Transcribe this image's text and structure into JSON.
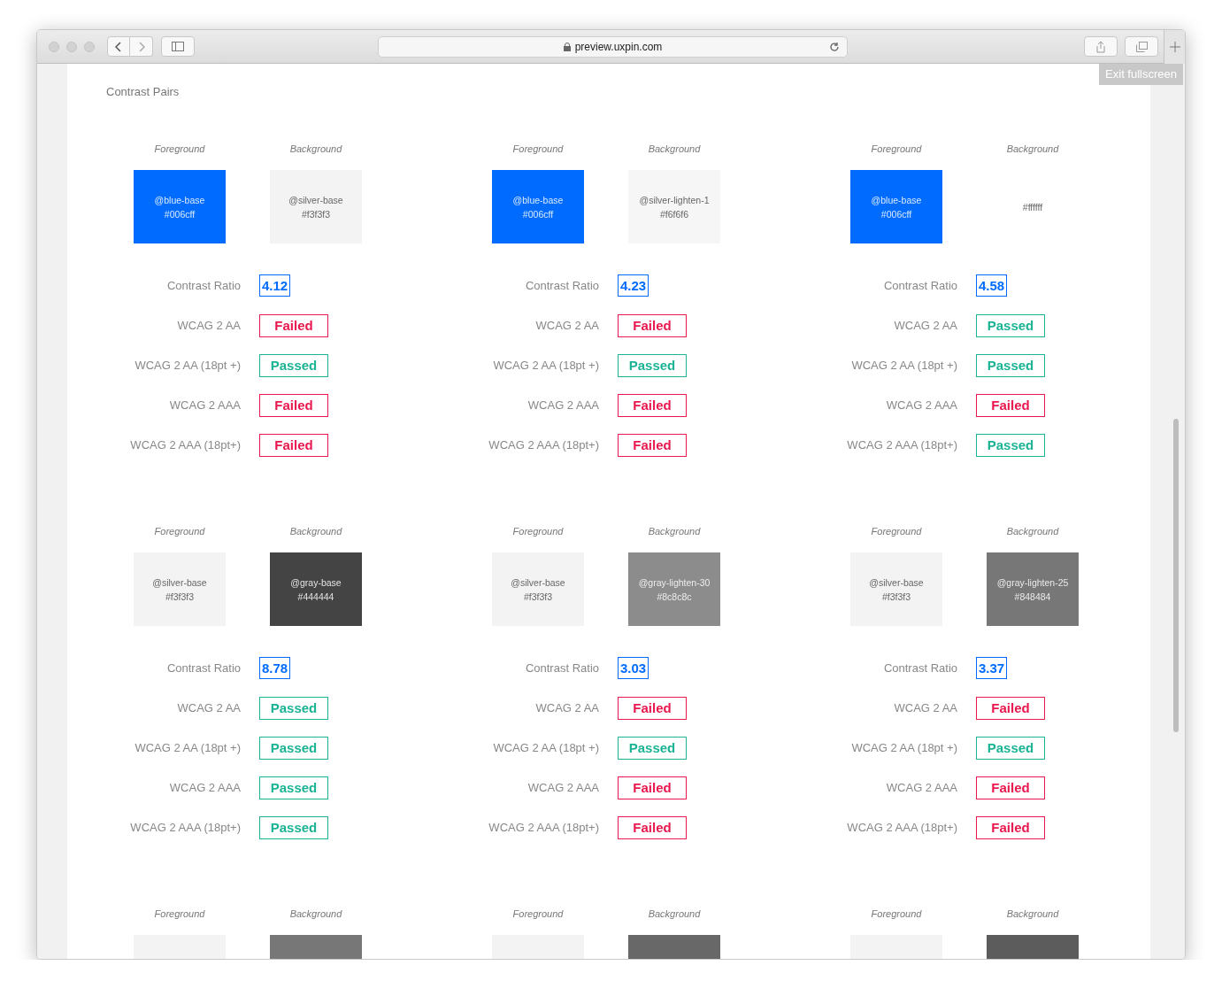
{
  "browser": {
    "address": "preview.uxpin.com",
    "overlay": "Exit fullscreen"
  },
  "page": {
    "title": "Contrast Pairs",
    "pairs": [
      {
        "foreground": {
          "label": "Foreground",
          "color": "#006cff",
          "name": "@blue-base",
          "hex": "#006cff"
        },
        "background": {
          "label": "Background",
          "color": "#f3f3f3",
          "name": "@silver-base",
          "hex": "#f3f3f3"
        },
        "ratio_label": "Contrast Ratio",
        "ratio": "4.12",
        "checks": [
          {
            "label": "WCAG 2 AA",
            "result": "Failed",
            "passed": false
          },
          {
            "label": "WCAG 2 AA (18pt +)",
            "result": "Passed",
            "passed": true
          },
          {
            "label": "WCAG 2 AAA",
            "result": "Failed",
            "passed": false
          },
          {
            "label": "WCAG 2 AAA (18pt+)",
            "result": "Failed",
            "passed": false
          }
        ]
      },
      {
        "foreground": {
          "label": "Foreground",
          "color": "#006cff",
          "name": "@blue-base",
          "hex": "#006cff"
        },
        "background": {
          "label": "Background",
          "color": "#f6f6f6",
          "name": "@silver-lighten-1",
          "hex": "#f6f6f6"
        },
        "ratio_label": "Contrast Ratio",
        "ratio": "4.23",
        "checks": [
          {
            "label": "WCAG 2 AA",
            "result": "Failed",
            "passed": false
          },
          {
            "label": "WCAG 2 AA (18pt +)",
            "result": "Passed",
            "passed": true
          },
          {
            "label": "WCAG 2 AAA",
            "result": "Failed",
            "passed": false
          },
          {
            "label": "WCAG 2 AAA (18pt+)",
            "result": "Failed",
            "passed": false
          }
        ]
      },
      {
        "foreground": {
          "label": "Foreground",
          "color": "#006cff",
          "name": "@blue-base",
          "hex": "#006cff"
        },
        "background": {
          "label": "Background",
          "color": "#ffffff",
          "hex": "#ffffff"
        },
        "ratio_label": "Contrast Ratio",
        "ratio": "4.58",
        "checks": [
          {
            "label": "WCAG 2 AA",
            "result": "Passed",
            "passed": true
          },
          {
            "label": "WCAG 2 AA (18pt +)",
            "result": "Passed",
            "passed": true
          },
          {
            "label": "WCAG 2 AAA",
            "result": "Failed",
            "passed": false
          },
          {
            "label": "WCAG 2 AAA (18pt+)",
            "result": "Passed",
            "passed": true
          }
        ]
      },
      {
        "foreground": {
          "label": "Foreground",
          "color": "#f3f3f3",
          "name": "@silver-base",
          "hex": "#f3f3f3"
        },
        "background": {
          "label": "Background",
          "color": "#444444",
          "name": "@gray-base",
          "hex": "#444444"
        },
        "ratio_label": "Contrast Ratio",
        "ratio": "8.78",
        "checks": [
          {
            "label": "WCAG 2 AA",
            "result": "Passed",
            "passed": true
          },
          {
            "label": "WCAG 2 AA (18pt +)",
            "result": "Passed",
            "passed": true
          },
          {
            "label": "WCAG 2 AAA",
            "result": "Passed",
            "passed": true
          },
          {
            "label": "WCAG 2 AAA (18pt+)",
            "result": "Passed",
            "passed": true
          }
        ]
      },
      {
        "foreground": {
          "label": "Foreground",
          "color": "#f3f3f3",
          "name": "@silver-base",
          "hex": "#f3f3f3"
        },
        "background": {
          "label": "Background",
          "color": "#8c8c8c",
          "name": "@gray-lighten-30",
          "hex": "#8c8c8c"
        },
        "ratio_label": "Contrast Ratio",
        "ratio": "3.03",
        "checks": [
          {
            "label": "WCAG 2 AA",
            "result": "Failed",
            "passed": false
          },
          {
            "label": "WCAG 2 AA (18pt +)",
            "result": "Passed",
            "passed": true
          },
          {
            "label": "WCAG 2 AAA",
            "result": "Failed",
            "passed": false
          },
          {
            "label": "WCAG 2 AAA (18pt+)",
            "result": "Failed",
            "passed": false
          }
        ]
      },
      {
        "foreground": {
          "label": "Foreground",
          "color": "#f3f3f3",
          "name": "@silver-base",
          "hex": "#f3f3f3"
        },
        "background": {
          "label": "Background",
          "color": "#777777",
          "name": "@gray-lighten-25",
          "hex": "#848484"
        },
        "ratio_label": "Contrast Ratio",
        "ratio": "3.37",
        "checks": [
          {
            "label": "WCAG 2 AA",
            "result": "Failed",
            "passed": false
          },
          {
            "label": "WCAG 2 AA (18pt +)",
            "result": "Passed",
            "passed": true
          },
          {
            "label": "WCAG 2 AAA",
            "result": "Failed",
            "passed": false
          },
          {
            "label": "WCAG 2 AAA (18pt+)",
            "result": "Failed",
            "passed": false
          }
        ]
      },
      {
        "foreground": {
          "label": "Foreground",
          "color": "#f3f3f3"
        },
        "background": {
          "label": "Background",
          "color": "#777777"
        }
      },
      {
        "foreground": {
          "label": "Foreground",
          "color": "#f3f3f3"
        },
        "background": {
          "label": "Background",
          "color": "#686868"
        }
      },
      {
        "foreground": {
          "label": "Foreground",
          "color": "#f3f3f3"
        },
        "background": {
          "label": "Background",
          "color": "#5c5c5c"
        }
      }
    ]
  }
}
